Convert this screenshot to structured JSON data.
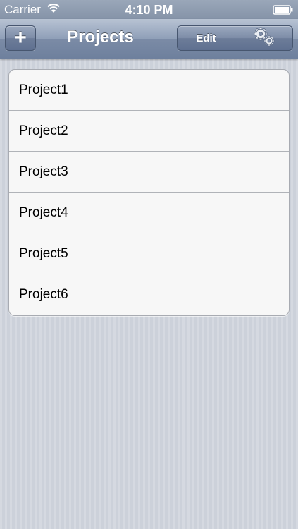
{
  "status_bar": {
    "carrier": "Carrier",
    "time": "4:10 PM",
    "wifi_icon": "wifi-icon",
    "battery_icon": "battery-icon"
  },
  "nav_bar": {
    "add_label": "+",
    "title": "Projects",
    "edit_label": "Edit",
    "settings_icon": "gears-icon"
  },
  "projects": [
    {
      "label": "Project1"
    },
    {
      "label": "Project2"
    },
    {
      "label": "Project3"
    },
    {
      "label": "Project4"
    },
    {
      "label": "Project5"
    },
    {
      "label": "Project6"
    }
  ],
  "colors": {
    "nav_bar": "#7b8ba6",
    "background": "#ccd1da",
    "list_background": "#f7f7f7"
  }
}
